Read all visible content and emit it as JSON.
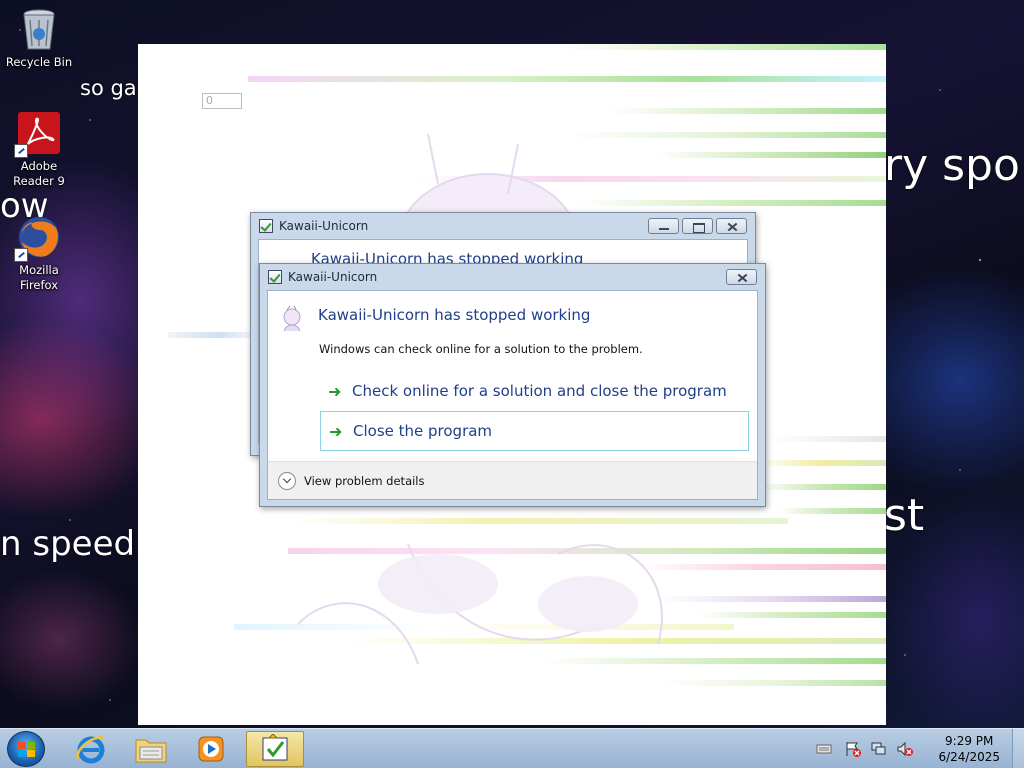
{
  "desktop": {
    "icons": [
      {
        "label": "Recycle Bin"
      },
      {
        "label": "Adobe Reader 9"
      },
      {
        "label": "Mozilla Firefox"
      }
    ],
    "wallpaper_text": {
      "left_top": "so gal",
      "left_mid": "ow",
      "left_bottom": "n speed",
      "right_top": "ry spo",
      "right_bottom": "st"
    }
  },
  "app_window": {
    "input_value": "0"
  },
  "background_dialog": {
    "title": "Kawaii-Unicorn",
    "heading": "Kawaii-Unicorn has stopped working"
  },
  "dialog": {
    "title": "Kawaii-Unicorn",
    "heading": "Kawaii-Unicorn has stopped working",
    "subtext": "Windows can check online for a solution to the problem.",
    "option_check": "Check online for a solution and close the program",
    "option_close": "Close the program",
    "details_label": "View problem details"
  },
  "taskbar": {
    "pinned": [
      {
        "icon": "internet-explorer-icon"
      },
      {
        "icon": "windows-explorer-icon"
      },
      {
        "icon": "media-player-icon"
      },
      {
        "icon": "kawaii-unicorn-icon",
        "active": true
      }
    ],
    "clock_time": "9:29 PM",
    "clock_date": "6/24/2025"
  },
  "colors": {
    "dialog_heading": "#1f3f8c",
    "arrow": "#1f9a2c",
    "taskbar": "#a9c0db",
    "selected_border": "#8ed0e3"
  }
}
